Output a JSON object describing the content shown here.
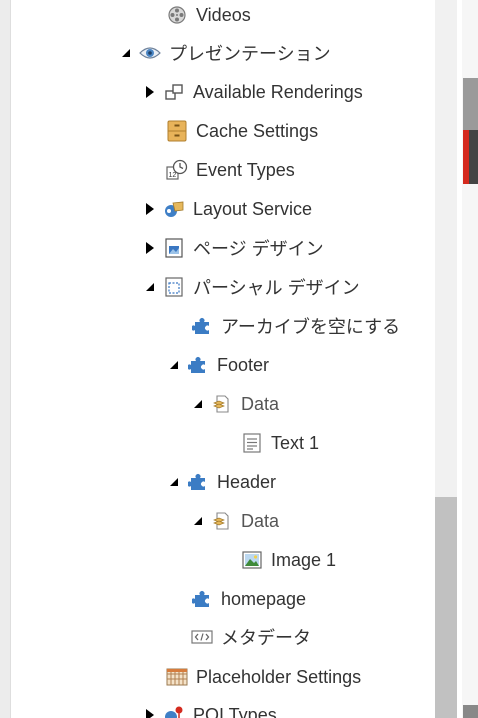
{
  "tree": {
    "items": [
      {
        "label": "Videos",
        "icon": "film-reel-icon",
        "toggle": "none"
      },
      {
        "label": "プレゼンテーション",
        "icon": "eye-icon",
        "toggle": "expanded"
      },
      {
        "label": "Available Renderings",
        "icon": "renderings-icon",
        "toggle": "collapsed"
      },
      {
        "label": "Cache Settings",
        "icon": "cabinet-icon",
        "toggle": "none"
      },
      {
        "label": "Event Types",
        "icon": "event-clock-icon",
        "toggle": "none"
      },
      {
        "label": "Layout Service",
        "icon": "layout-service-icon",
        "toggle": "collapsed"
      },
      {
        "label": "ページ デザイン",
        "icon": "page-design-icon",
        "toggle": "collapsed"
      },
      {
        "label": "パーシャル デザイン",
        "icon": "partial-design-icon",
        "toggle": "expanded"
      },
      {
        "label": "アーカイブを空にする",
        "icon": "puzzle-icon",
        "toggle": "none"
      },
      {
        "label": "Footer",
        "icon": "puzzle-icon",
        "toggle": "expanded"
      },
      {
        "label": "Data",
        "icon": "data-folder-icon",
        "toggle": "expanded"
      },
      {
        "label": "Text 1",
        "icon": "text-document-icon",
        "toggle": "none"
      },
      {
        "label": "Header",
        "icon": "puzzle-icon",
        "toggle": "expanded"
      },
      {
        "label": "Data",
        "icon": "data-folder-icon",
        "toggle": "expanded"
      },
      {
        "label": "Image 1",
        "icon": "image-icon",
        "toggle": "none"
      },
      {
        "label": "homepage",
        "icon": "puzzle-icon",
        "toggle": "none"
      },
      {
        "label": "メタデータ",
        "icon": "code-tag-icon",
        "toggle": "none"
      },
      {
        "label": "Placeholder Settings",
        "icon": "placeholder-grid-icon",
        "toggle": "none"
      },
      {
        "label": "POI Types",
        "icon": "poi-types-icon",
        "toggle": "collapsed"
      }
    ]
  },
  "colors": {
    "puzzle": "#3b7cc4",
    "scroll_thumb": "#c1c1c1",
    "accent_red": "#d42a1e"
  }
}
